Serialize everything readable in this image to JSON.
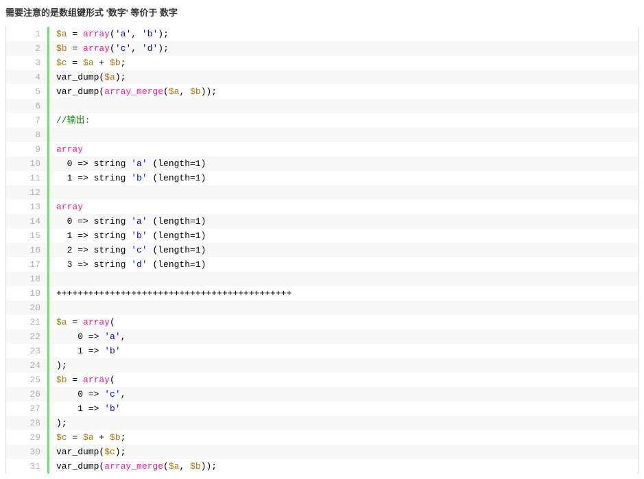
{
  "title": "需要注意的是数组键形式 '数字' 等价于 数字",
  "lines": [
    {
      "n": 1,
      "tokens": [
        {
          "c": "var",
          "t": "$a"
        },
        {
          "c": "plain",
          "t": " = "
        },
        {
          "c": "fn",
          "t": "array"
        },
        {
          "c": "plain",
          "t": "("
        },
        {
          "c": "str",
          "t": "'a'"
        },
        {
          "c": "plain",
          "t": ", "
        },
        {
          "c": "str",
          "t": "'b'"
        },
        {
          "c": "plain",
          "t": ");"
        }
      ]
    },
    {
      "n": 2,
      "tokens": [
        {
          "c": "var",
          "t": "$b"
        },
        {
          "c": "plain",
          "t": " = "
        },
        {
          "c": "fn",
          "t": "array"
        },
        {
          "c": "plain",
          "t": "("
        },
        {
          "c": "str",
          "t": "'c'"
        },
        {
          "c": "plain",
          "t": ", "
        },
        {
          "c": "str",
          "t": "'d'"
        },
        {
          "c": "plain",
          "t": ");"
        }
      ]
    },
    {
      "n": 3,
      "tokens": [
        {
          "c": "var",
          "t": "$c"
        },
        {
          "c": "plain",
          "t": " = "
        },
        {
          "c": "var",
          "t": "$a"
        },
        {
          "c": "plain",
          "t": " + "
        },
        {
          "c": "var",
          "t": "$b"
        },
        {
          "c": "plain",
          "t": ";"
        }
      ]
    },
    {
      "n": 4,
      "tokens": [
        {
          "c": "plain",
          "t": "var_dump("
        },
        {
          "c": "var",
          "t": "$a"
        },
        {
          "c": "plain",
          "t": ");"
        }
      ]
    },
    {
      "n": 5,
      "tokens": [
        {
          "c": "plain",
          "t": "var_dump("
        },
        {
          "c": "fn",
          "t": "array_merge"
        },
        {
          "c": "plain",
          "t": "("
        },
        {
          "c": "var",
          "t": "$a"
        },
        {
          "c": "plain",
          "t": ", "
        },
        {
          "c": "var",
          "t": "$b"
        },
        {
          "c": "plain",
          "t": "));"
        }
      ]
    },
    {
      "n": 6,
      "tokens": [
        {
          "c": "plain",
          "t": " "
        }
      ]
    },
    {
      "n": 7,
      "tokens": [
        {
          "c": "com",
          "t": "//输出:"
        }
      ]
    },
    {
      "n": 8,
      "tokens": [
        {
          "c": "plain",
          "t": " "
        }
      ]
    },
    {
      "n": 9,
      "tokens": [
        {
          "c": "fn",
          "t": "array"
        }
      ]
    },
    {
      "n": 10,
      "tokens": [
        {
          "c": "plain",
          "t": "  0 => string "
        },
        {
          "c": "str",
          "t": "'a'"
        },
        {
          "c": "plain",
          "t": " (length=1)"
        }
      ]
    },
    {
      "n": 11,
      "tokens": [
        {
          "c": "plain",
          "t": "  1 => string "
        },
        {
          "c": "str",
          "t": "'b'"
        },
        {
          "c": "plain",
          "t": " (length=1)"
        }
      ]
    },
    {
      "n": 12,
      "tokens": [
        {
          "c": "plain",
          "t": " "
        }
      ]
    },
    {
      "n": 13,
      "tokens": [
        {
          "c": "fn",
          "t": "array"
        }
      ]
    },
    {
      "n": 14,
      "tokens": [
        {
          "c": "plain",
          "t": "  0 => string "
        },
        {
          "c": "str",
          "t": "'a'"
        },
        {
          "c": "plain",
          "t": " (length=1)"
        }
      ]
    },
    {
      "n": 15,
      "tokens": [
        {
          "c": "plain",
          "t": "  1 => string "
        },
        {
          "c": "str",
          "t": "'b'"
        },
        {
          "c": "plain",
          "t": " (length=1)"
        }
      ]
    },
    {
      "n": 16,
      "tokens": [
        {
          "c": "plain",
          "t": "  2 => string "
        },
        {
          "c": "str",
          "t": "'c'"
        },
        {
          "c": "plain",
          "t": " (length=1)"
        }
      ]
    },
    {
      "n": 17,
      "tokens": [
        {
          "c": "plain",
          "t": "  3 => string "
        },
        {
          "c": "str",
          "t": "'d'"
        },
        {
          "c": "plain",
          "t": " (length=1)"
        }
      ]
    },
    {
      "n": 18,
      "tokens": [
        {
          "c": "plain",
          "t": " "
        }
      ]
    },
    {
      "n": 19,
      "tokens": [
        {
          "c": "plain",
          "t": "++++++++++++++++++++++++++++++++++++++++++++"
        }
      ]
    },
    {
      "n": 20,
      "tokens": [
        {
          "c": "plain",
          "t": " "
        }
      ]
    },
    {
      "n": 21,
      "tokens": [
        {
          "c": "var",
          "t": "$a"
        },
        {
          "c": "plain",
          "t": " = "
        },
        {
          "c": "fn",
          "t": "array"
        },
        {
          "c": "plain",
          "t": "("
        }
      ]
    },
    {
      "n": 22,
      "tokens": [
        {
          "c": "plain",
          "t": "    0 => "
        },
        {
          "c": "str",
          "t": "'a'"
        },
        {
          "c": "plain",
          "t": ","
        }
      ]
    },
    {
      "n": 23,
      "tokens": [
        {
          "c": "plain",
          "t": "    1 => "
        },
        {
          "c": "str",
          "t": "'b'"
        }
      ]
    },
    {
      "n": 24,
      "tokens": [
        {
          "c": "plain",
          "t": ");"
        }
      ]
    },
    {
      "n": 25,
      "tokens": [
        {
          "c": "var",
          "t": "$b"
        },
        {
          "c": "plain",
          "t": " = "
        },
        {
          "c": "fn",
          "t": "array"
        },
        {
          "c": "plain",
          "t": "("
        }
      ]
    },
    {
      "n": 26,
      "tokens": [
        {
          "c": "plain",
          "t": "    0 => "
        },
        {
          "c": "str",
          "t": "'c'"
        },
        {
          "c": "plain",
          "t": ","
        }
      ]
    },
    {
      "n": 27,
      "tokens": [
        {
          "c": "plain",
          "t": "    1 => "
        },
        {
          "c": "str",
          "t": "'b'"
        }
      ]
    },
    {
      "n": 28,
      "tokens": [
        {
          "c": "plain",
          "t": ");"
        }
      ]
    },
    {
      "n": 29,
      "tokens": [
        {
          "c": "var",
          "t": "$c"
        },
        {
          "c": "plain",
          "t": " = "
        },
        {
          "c": "var",
          "t": "$a"
        },
        {
          "c": "plain",
          "t": " + "
        },
        {
          "c": "var",
          "t": "$b"
        },
        {
          "c": "plain",
          "t": ";"
        }
      ]
    },
    {
      "n": 30,
      "tokens": [
        {
          "c": "plain",
          "t": "var_dump("
        },
        {
          "c": "var",
          "t": "$c"
        },
        {
          "c": "plain",
          "t": ");"
        }
      ]
    },
    {
      "n": 31,
      "tokens": [
        {
          "c": "plain",
          "t": "var_dump("
        },
        {
          "c": "fn",
          "t": "array_merge"
        },
        {
          "c": "plain",
          "t": "("
        },
        {
          "c": "var",
          "t": "$a"
        },
        {
          "c": "plain",
          "t": ", "
        },
        {
          "c": "var",
          "t": "$b"
        },
        {
          "c": "plain",
          "t": "));"
        }
      ]
    }
  ]
}
